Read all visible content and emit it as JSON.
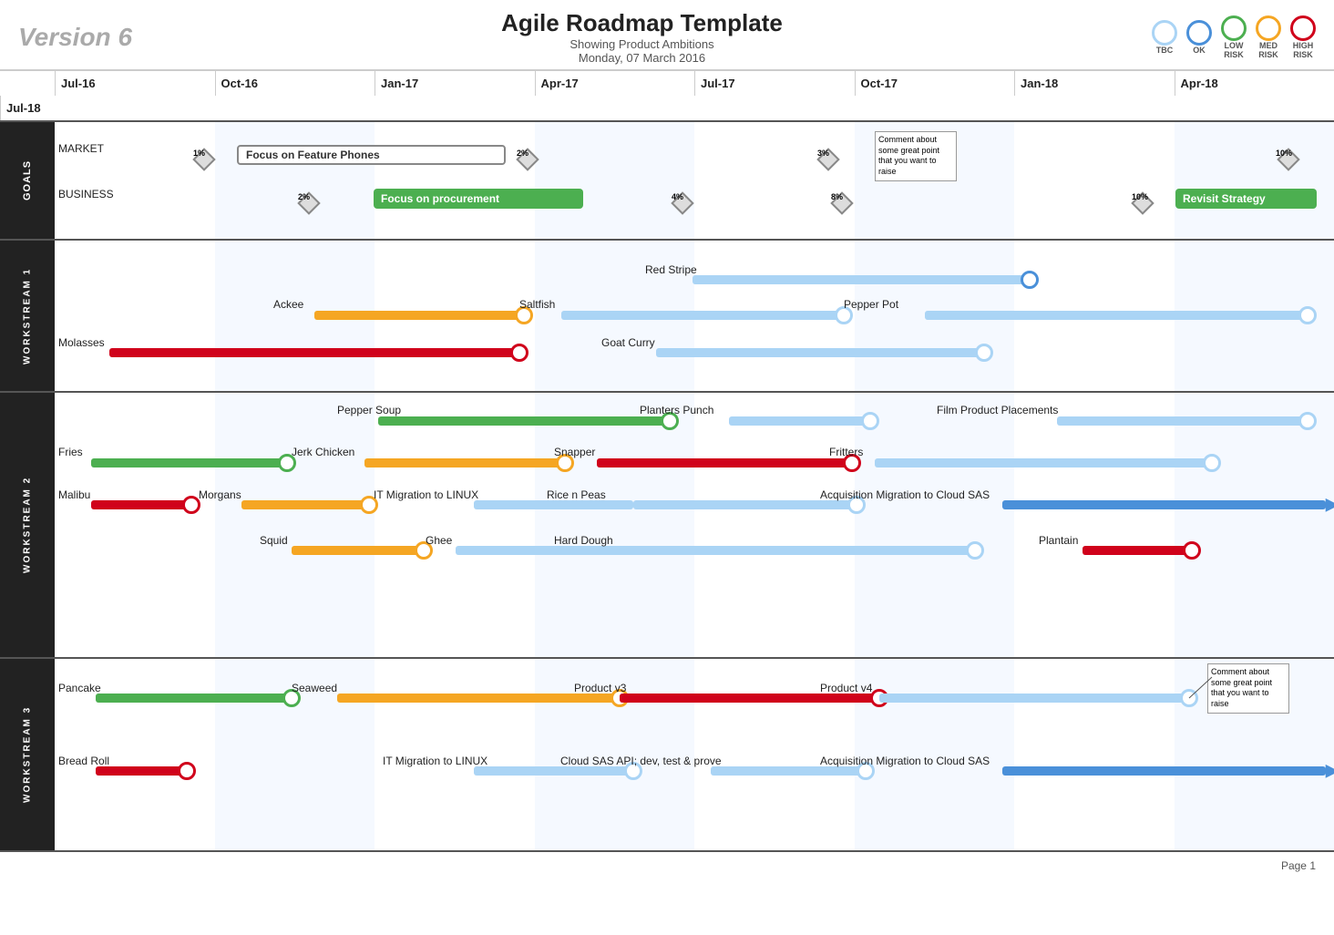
{
  "header": {
    "version": "Version 6",
    "title": "Agile Roadmap Template",
    "subtitle": "Showing Product Ambitions",
    "date": "Monday, 07 March 2016"
  },
  "legend": {
    "items": [
      {
        "label": "TBC",
        "class": "lc-tbc"
      },
      {
        "label": "OK",
        "class": "lc-ok"
      },
      {
        "label": "LOW\nRISK",
        "class": "lc-low"
      },
      {
        "label": "MED\nRISK",
        "class": "lc-med"
      },
      {
        "label": "HIGH\nRISK",
        "class": "lc-high"
      }
    ]
  },
  "timeline": {
    "columns": [
      "Jul-16",
      "Oct-16",
      "Jan-17",
      "Apr-17",
      "Jul-17",
      "Oct-17",
      "Jan-18",
      "Apr-18",
      "Jul-18"
    ]
  },
  "sections": {
    "goals": {
      "label": "GOALS",
      "market_label": "MARKET",
      "business_label": "BUSINESS",
      "focus_feature": "Focus on Feature Phones",
      "focus_procurement": "Focus on procurement",
      "revisit": "Revisit Strategy",
      "comment": "Comment about some great point that you want to raise"
    },
    "ws1": {
      "label": "WORKSTREAM 1",
      "items": [
        "Red Stripe",
        "Ackee",
        "Saltfish",
        "Pepper Pot",
        "Molasses",
        "Goat Curry"
      ]
    },
    "ws2": {
      "label": "WORKSTREAM 2",
      "items": [
        "Pepper Soup",
        "Planters Punch",
        "Film Product Placements",
        "Fries",
        "Jerk Chicken",
        "Snapper",
        "Fritters",
        "Malibu",
        "Morgans",
        "IT Migration to LINUX",
        "Rice n Peas",
        "Acquisition Migration to Cloud SAS",
        "Squid",
        "Ghee",
        "Hard Dough",
        "Plantain"
      ]
    },
    "ws3": {
      "label": "WORKSTREAM 3",
      "items": [
        "Pancake",
        "Seaweed",
        "Product v3",
        "Product v4",
        "Bread Roll",
        "IT Migration to LINUX",
        "Cloud SAS API; dev, test & prove",
        "Acquisition Migration to Cloud SAS"
      ]
    }
  },
  "page": "Page 1"
}
